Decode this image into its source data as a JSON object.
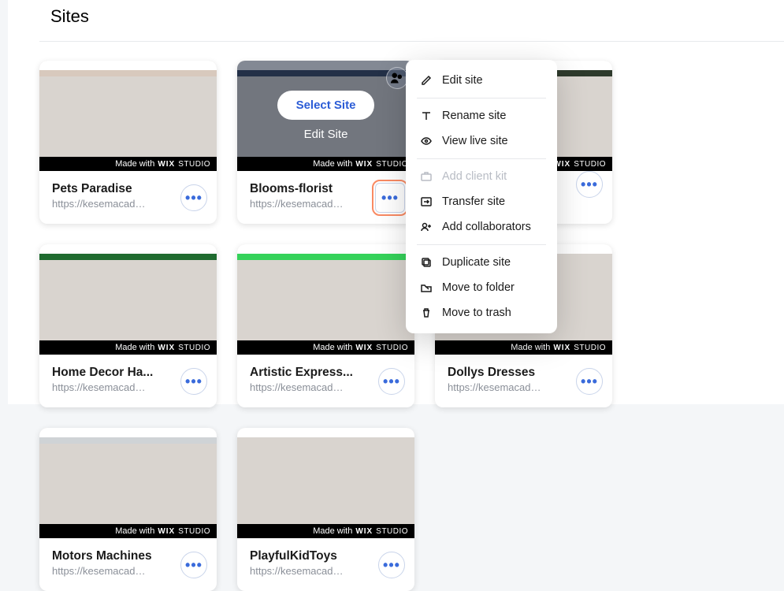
{
  "page": {
    "title": "Sites"
  },
  "badge": {
    "madeWith": "Made with",
    "brand": "WIX",
    "suffix": "STUDIO"
  },
  "overlay": {
    "select": "Select Site",
    "edit": "Edit Site"
  },
  "cards": [
    {
      "title": "Pets Paradise",
      "url": "https://kesemacad…",
      "strip": "#d8c9bd"
    },
    {
      "title": "Blooms-florist",
      "url": "https://kesemacad…",
      "strip": "#2b3a55",
      "hover": true
    },
    {
      "title": "",
      "url": "",
      "strip": "#2e3a2c"
    },
    {
      "title": "Home Decor Ha...",
      "url": "https://kesemacad…",
      "strip": "#1f6b2f"
    },
    {
      "title": "Artistic Express...",
      "url": "https://kesemacad…",
      "strip": "#35d25a"
    },
    {
      "title": "Dollys Dresses",
      "url": "https://kesemacad…",
      "strip": "#d9d4cf"
    },
    {
      "title": "Motors Machines",
      "url": "https://kesemacad…",
      "strip": "#cfd3d6"
    },
    {
      "title": "PlayfulKidToys",
      "url": "https://kesemacad…",
      "strip": "#d9d4cf"
    }
  ],
  "menu": {
    "items": [
      {
        "label": "Edit site",
        "icon": "pencil"
      },
      {
        "sep": true
      },
      {
        "label": "Rename site",
        "icon": "text"
      },
      {
        "label": "View live site",
        "icon": "eye"
      },
      {
        "sep": true
      },
      {
        "label": "Add client kit",
        "icon": "briefcase",
        "disabled": true
      },
      {
        "label": "Transfer site",
        "icon": "transfer"
      },
      {
        "label": "Add collaborators",
        "icon": "user-plus"
      },
      {
        "sep": true
      },
      {
        "label": "Duplicate site",
        "icon": "duplicate"
      },
      {
        "label": "Move to folder",
        "icon": "folder"
      },
      {
        "label": "Move to trash",
        "icon": "trash"
      }
    ]
  }
}
